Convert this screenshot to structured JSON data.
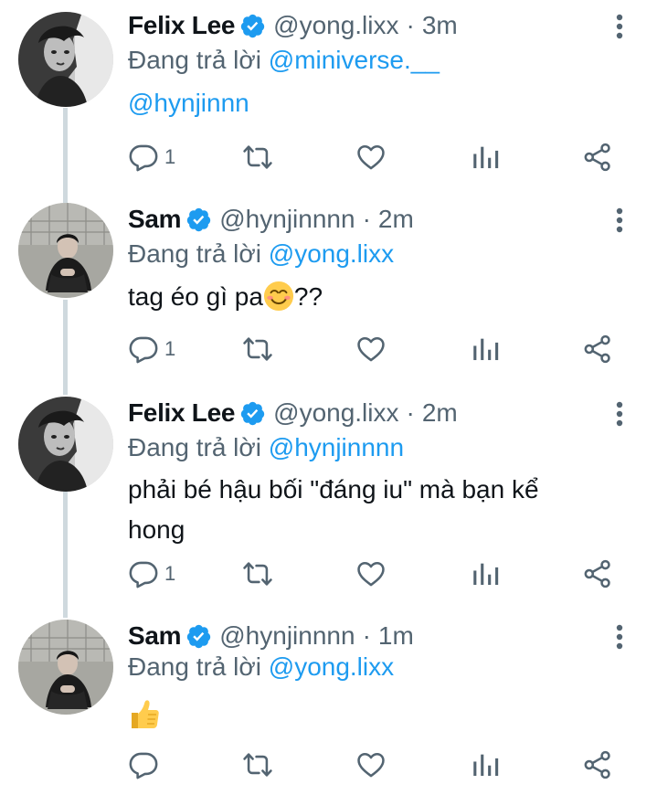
{
  "tweets": [
    {
      "name": "Felix Lee",
      "handle": "@yong.lixx",
      "separator": "·",
      "time": "3m",
      "replying_prefix": "Đang trả lời ",
      "replying_to": "@miniverse.__",
      "body_mention": "@hynjinnn",
      "reply_count": "1",
      "avatar": "felix-avatar"
    },
    {
      "name": "Sam",
      "handle": "@hynjinnnn",
      "separator": "·",
      "time": "2m",
      "replying_prefix": "Đang trả lời ",
      "replying_to": "@yong.lixx",
      "body_text": "tag éo gì pa",
      "body_suffix": "??",
      "body_emoji": "smiling-face-emoji",
      "reply_count": "1",
      "avatar": "sam-avatar"
    },
    {
      "name": "Felix Lee",
      "handle": "@yong.lixx",
      "separator": "·",
      "time": "2m",
      "replying_prefix": "Đang trả lời ",
      "replying_to": "@hynjinnnn",
      "body_text": "phải bé hậu bối \"đáng iu\" mà bạn kể hong",
      "reply_count": "1",
      "avatar": "felix-avatar"
    },
    {
      "name": "Sam",
      "handle": "@hynjinnnn",
      "separator": "·",
      "time": "1m",
      "replying_prefix": "Đang trả lời ",
      "replying_to": "@yong.lixx",
      "body_emoji": "thumbs-up-emoji",
      "reply_count": "",
      "avatar": "sam-avatar"
    }
  ],
  "colors": {
    "link": "#1d9bf0",
    "muted": "#536471",
    "verified": "#1d9bf0",
    "thread_line": "#cfd9de"
  },
  "icons": [
    "verified-badge-icon",
    "more-vertical-icon",
    "reply-icon",
    "retweet-icon",
    "like-icon",
    "analytics-icon",
    "share-icon"
  ]
}
